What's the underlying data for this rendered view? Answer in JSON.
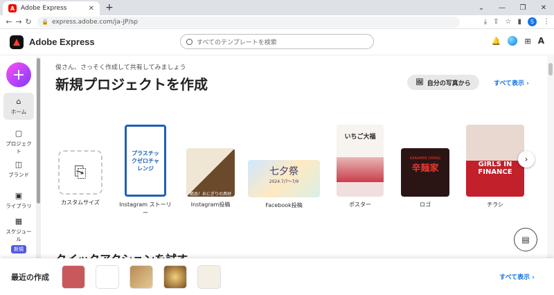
{
  "browser": {
    "tab_title": "Adobe Express",
    "url": "express.adobe.com/ja-JP/sp"
  },
  "app": {
    "name": "Adobe Express",
    "search_placeholder": "すべてのテンプレートを検索"
  },
  "sidebar": {
    "items": [
      {
        "label": "ホーム",
        "icon": "home-icon"
      },
      {
        "label": "プロジェクト",
        "icon": "file-icon"
      },
      {
        "label": "ブランド",
        "icon": "brand-icon"
      },
      {
        "label": "ライブラリ",
        "icon": "library-icon"
      },
      {
        "label": "スケジュール",
        "icon": "calendar-icon",
        "badge": "新規"
      }
    ]
  },
  "main": {
    "greeting": "俊さん、さっそく作成して共有してみましょう",
    "title": "新規プロジェクトを作成",
    "photo_button": "自分の写真から",
    "see_all": "すべて表示",
    "cards": [
      {
        "label": "カスタムサイズ"
      },
      {
        "label": "Instagram ストーリー"
      },
      {
        "label": "Instagram投稿"
      },
      {
        "label": "Facebook投稿"
      },
      {
        "label": "ポスター"
      },
      {
        "label": "ロゴ"
      },
      {
        "label": "チラシ"
      }
    ],
    "thumb_texts": {
      "story": "プラスチックゼロチャレンジ",
      "ig_post": "絶品！おにぎりの具材",
      "fb": "七夕祭",
      "fb_date": "2024.7/7〜7/9",
      "poster": "いちご大福",
      "logo_en": "KARAMEN DINING",
      "logo_jp": "辛麺家",
      "flyer": "GIRLS IN FINANCE"
    },
    "quick_actions": "クイックアクションを試す"
  },
  "recent": {
    "title": "最近の作成",
    "see_all": "すべて表示"
  },
  "colors": {
    "accent": "#1473e6",
    "plus_gradient": "#ff4df2"
  }
}
